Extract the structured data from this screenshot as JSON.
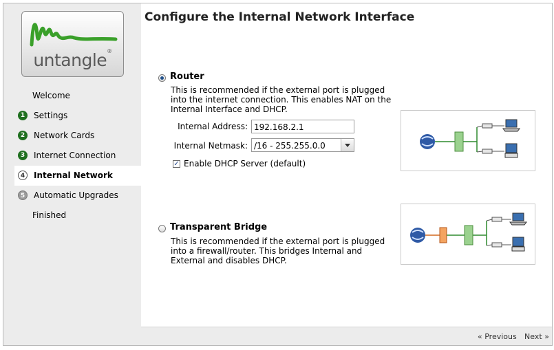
{
  "logo": {
    "text": "untangle",
    "mark": "®"
  },
  "sidebar": {
    "items": [
      {
        "label": "Welcome",
        "number": "",
        "state": "plain"
      },
      {
        "label": "Settings",
        "number": "1",
        "state": "done"
      },
      {
        "label": "Network Cards",
        "number": "2",
        "state": "done"
      },
      {
        "label": "Internet Connection",
        "number": "3",
        "state": "done"
      },
      {
        "label": "Internal Network",
        "number": "4",
        "state": "current"
      },
      {
        "label": "Automatic Upgrades",
        "number": "5",
        "state": "future"
      },
      {
        "label": "Finished",
        "number": "",
        "state": "plain"
      }
    ]
  },
  "main": {
    "title": "Configure the Internal Network Interface",
    "router": {
      "title": "Router",
      "selected": true,
      "description": "This is recommended if the external port is plugged into the internet connection. This enables NAT on the Internal Interface and DHCP.",
      "address_label": "Internal Address:",
      "address_value": "192.168.2.1",
      "netmask_label": "Internal Netmask:",
      "netmask_value": "/16 - 255.255.0.0",
      "dhcp_label": "Enable DHCP Server (default)",
      "dhcp_checked": true
    },
    "bridge": {
      "title": "Transparent Bridge",
      "selected": false,
      "description": "This is recommended if the external port is plugged into a firewall/router. This bridges Internal and External and disables DHCP."
    }
  },
  "footer": {
    "previous": "« Previous",
    "next": "Next »"
  },
  "colors": {
    "sidebar_bg": "#ececec",
    "done_step": "#1f6f1f",
    "logo_green": "#3aa02a"
  }
}
